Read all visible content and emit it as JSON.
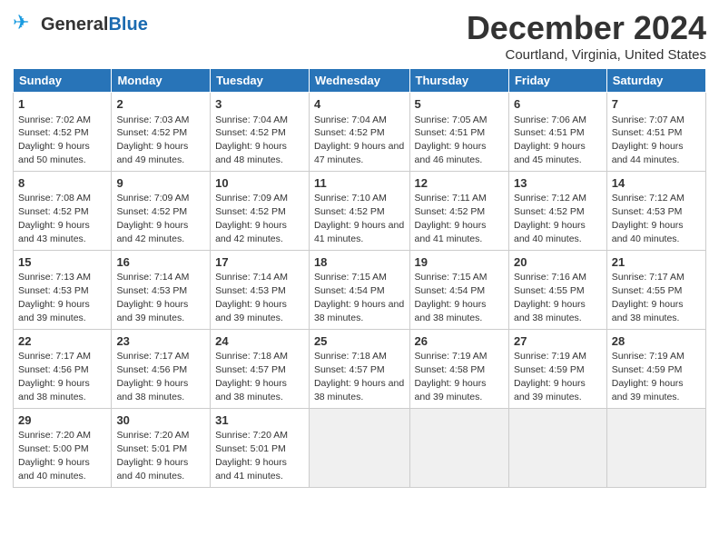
{
  "header": {
    "logo_general": "General",
    "logo_blue": "Blue",
    "month_title": "December 2024",
    "location": "Courtland, Virginia, United States"
  },
  "days_of_week": [
    "Sunday",
    "Monday",
    "Tuesday",
    "Wednesday",
    "Thursday",
    "Friday",
    "Saturday"
  ],
  "weeks": [
    [
      {
        "day": "1",
        "sunrise": "7:02 AM",
        "sunset": "4:52 PM",
        "daylight": "9 hours and 50 minutes."
      },
      {
        "day": "2",
        "sunrise": "7:03 AM",
        "sunset": "4:52 PM",
        "daylight": "9 hours and 49 minutes."
      },
      {
        "day": "3",
        "sunrise": "7:04 AM",
        "sunset": "4:52 PM",
        "daylight": "9 hours and 48 minutes."
      },
      {
        "day": "4",
        "sunrise": "7:04 AM",
        "sunset": "4:52 PM",
        "daylight": "9 hours and 47 minutes."
      },
      {
        "day": "5",
        "sunrise": "7:05 AM",
        "sunset": "4:51 PM",
        "daylight": "9 hours and 46 minutes."
      },
      {
        "day": "6",
        "sunrise": "7:06 AM",
        "sunset": "4:51 PM",
        "daylight": "9 hours and 45 minutes."
      },
      {
        "day": "7",
        "sunrise": "7:07 AM",
        "sunset": "4:51 PM",
        "daylight": "9 hours and 44 minutes."
      }
    ],
    [
      {
        "day": "8",
        "sunrise": "7:08 AM",
        "sunset": "4:52 PM",
        "daylight": "9 hours and 43 minutes."
      },
      {
        "day": "9",
        "sunrise": "7:09 AM",
        "sunset": "4:52 PM",
        "daylight": "9 hours and 42 minutes."
      },
      {
        "day": "10",
        "sunrise": "7:09 AM",
        "sunset": "4:52 PM",
        "daylight": "9 hours and 42 minutes."
      },
      {
        "day": "11",
        "sunrise": "7:10 AM",
        "sunset": "4:52 PM",
        "daylight": "9 hours and 41 minutes."
      },
      {
        "day": "12",
        "sunrise": "7:11 AM",
        "sunset": "4:52 PM",
        "daylight": "9 hours and 41 minutes."
      },
      {
        "day": "13",
        "sunrise": "7:12 AM",
        "sunset": "4:52 PM",
        "daylight": "9 hours and 40 minutes."
      },
      {
        "day": "14",
        "sunrise": "7:12 AM",
        "sunset": "4:53 PM",
        "daylight": "9 hours and 40 minutes."
      }
    ],
    [
      {
        "day": "15",
        "sunrise": "7:13 AM",
        "sunset": "4:53 PM",
        "daylight": "9 hours and 39 minutes."
      },
      {
        "day": "16",
        "sunrise": "7:14 AM",
        "sunset": "4:53 PM",
        "daylight": "9 hours and 39 minutes."
      },
      {
        "day": "17",
        "sunrise": "7:14 AM",
        "sunset": "4:53 PM",
        "daylight": "9 hours and 39 minutes."
      },
      {
        "day": "18",
        "sunrise": "7:15 AM",
        "sunset": "4:54 PM",
        "daylight": "9 hours and 38 minutes."
      },
      {
        "day": "19",
        "sunrise": "7:15 AM",
        "sunset": "4:54 PM",
        "daylight": "9 hours and 38 minutes."
      },
      {
        "day": "20",
        "sunrise": "7:16 AM",
        "sunset": "4:55 PM",
        "daylight": "9 hours and 38 minutes."
      },
      {
        "day": "21",
        "sunrise": "7:17 AM",
        "sunset": "4:55 PM",
        "daylight": "9 hours and 38 minutes."
      }
    ],
    [
      {
        "day": "22",
        "sunrise": "7:17 AM",
        "sunset": "4:56 PM",
        "daylight": "9 hours and 38 minutes."
      },
      {
        "day": "23",
        "sunrise": "7:17 AM",
        "sunset": "4:56 PM",
        "daylight": "9 hours and 38 minutes."
      },
      {
        "day": "24",
        "sunrise": "7:18 AM",
        "sunset": "4:57 PM",
        "daylight": "9 hours and 38 minutes."
      },
      {
        "day": "25",
        "sunrise": "7:18 AM",
        "sunset": "4:57 PM",
        "daylight": "9 hours and 38 minutes."
      },
      {
        "day": "26",
        "sunrise": "7:19 AM",
        "sunset": "4:58 PM",
        "daylight": "9 hours and 39 minutes."
      },
      {
        "day": "27",
        "sunrise": "7:19 AM",
        "sunset": "4:59 PM",
        "daylight": "9 hours and 39 minutes."
      },
      {
        "day": "28",
        "sunrise": "7:19 AM",
        "sunset": "4:59 PM",
        "daylight": "9 hours and 39 minutes."
      }
    ],
    [
      {
        "day": "29",
        "sunrise": "7:20 AM",
        "sunset": "5:00 PM",
        "daylight": "9 hours and 40 minutes."
      },
      {
        "day": "30",
        "sunrise": "7:20 AM",
        "sunset": "5:01 PM",
        "daylight": "9 hours and 40 minutes."
      },
      {
        "day": "31",
        "sunrise": "7:20 AM",
        "sunset": "5:01 PM",
        "daylight": "9 hours and 41 minutes."
      },
      null,
      null,
      null,
      null
    ]
  ]
}
